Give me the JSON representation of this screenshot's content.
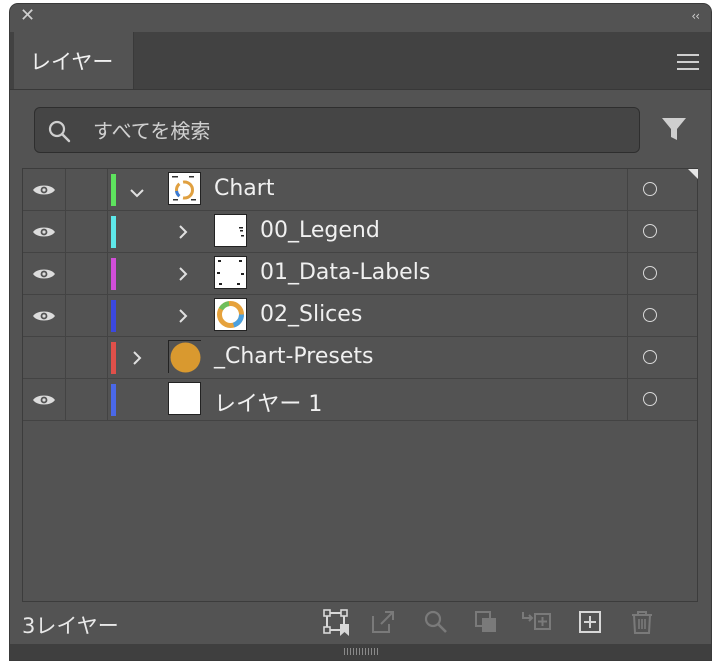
{
  "panel": {
    "tab_label": "レイヤー",
    "search_placeholder": "すべてを検索",
    "footer_count": "3レイヤー"
  },
  "layers": [
    {
      "name": "Chart",
      "visible": true,
      "color": "#5ee35e",
      "expand": "open",
      "indent": 0,
      "thumb": "chart-thumb"
    },
    {
      "name": "00_Legend",
      "visible": true,
      "color": "#5ee8ea",
      "expand": "closed",
      "indent": 1,
      "thumb": "legend-thumb"
    },
    {
      "name": "01_Data-Labels",
      "visible": true,
      "color": "#d24ed8",
      "expand": "closed",
      "indent": 1,
      "thumb": "labels-thumb"
    },
    {
      "name": "02_Slices",
      "visible": true,
      "color": "#3b48e0",
      "expand": "closed",
      "indent": 1,
      "thumb": "slices-thumb"
    },
    {
      "name": "_Chart-Presets",
      "visible": false,
      "color": "#e0504a",
      "expand": "closed",
      "indent": 0,
      "thumb": "preset-thumb"
    },
    {
      "name": "レイヤー 1",
      "visible": true,
      "color": "#4a68e8",
      "expand": "none",
      "indent": 0,
      "thumb": "blank-thumb"
    }
  ],
  "icons": {
    "eye": "eye-icon",
    "search": "search-icon",
    "filter": "filter-icon",
    "menu": "hamburger-menu-icon",
    "close": "close-icon",
    "collapse": "collapse-panel-icon",
    "footer_tools": [
      "collect-for-export-icon",
      "export-selection-icon",
      "locate-object-icon",
      "make-clipping-mask-icon",
      "create-sublayer-icon",
      "create-new-layer-icon",
      "delete-layer-icon"
    ]
  }
}
